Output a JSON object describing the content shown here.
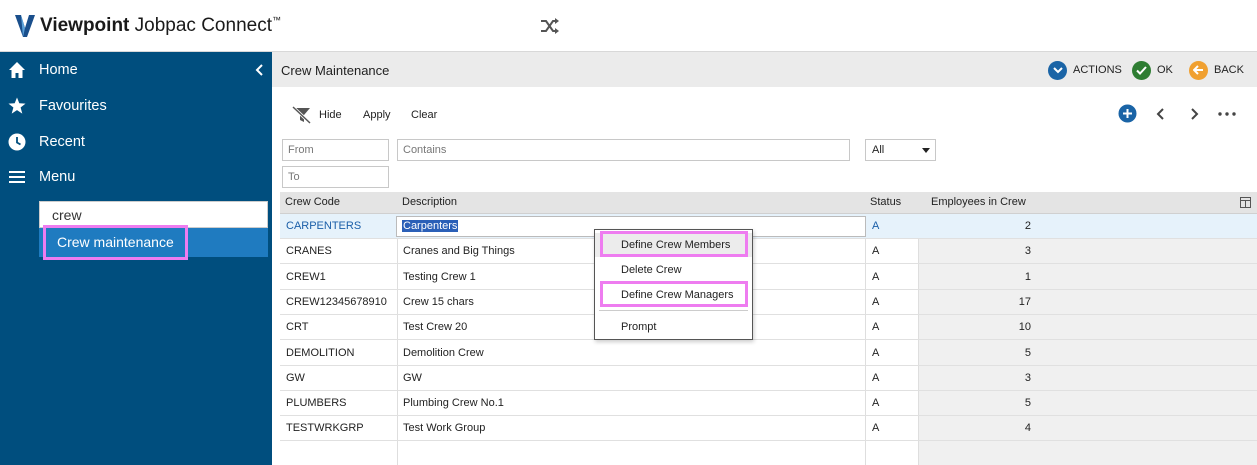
{
  "app": {
    "brand_bold": "Viewpoint",
    "brand_rest": " Jobpac Connect",
    "trademark": "™"
  },
  "sidebar": {
    "items": [
      {
        "label": "Home",
        "icon": "home-icon"
      },
      {
        "label": "Favourites",
        "icon": "star-icon"
      },
      {
        "label": "Recent",
        "icon": "clock-icon"
      },
      {
        "label": "Menu",
        "icon": "hamburger-icon"
      }
    ],
    "search_value": "crew",
    "result_label": "Crew maintenance"
  },
  "header": {
    "title": "Crew Maintenance",
    "actions_label": "ACTIONS",
    "ok_label": "OK",
    "back_label": "BACK"
  },
  "filters": {
    "hide_label": "Hide",
    "apply_label": "Apply",
    "clear_label": "Clear",
    "from_placeholder": "From",
    "to_placeholder": "To",
    "contains_placeholder": "Contains",
    "status_selected": "All"
  },
  "table": {
    "columns": [
      "Crew Code",
      "Description",
      "Status",
      "Employees in Crew"
    ],
    "rows": [
      {
        "code": "CARPENTERS",
        "description": "Carpenters",
        "status": "A",
        "employees": "2"
      },
      {
        "code": "CRANES",
        "description": "Cranes and Big Things",
        "status": "A",
        "employees": "3"
      },
      {
        "code": "CREW1",
        "description": "Testing Crew 1",
        "status": "A",
        "employees": "1"
      },
      {
        "code": "CREW12345678910",
        "description": "Crew 15 chars",
        "status": "A",
        "employees": "17"
      },
      {
        "code": "CRT",
        "description": "Test Crew 20",
        "status": "A",
        "employees": "10"
      },
      {
        "code": "DEMOLITION",
        "description": "Demolition Crew",
        "status": "A",
        "employees": "5"
      },
      {
        "code": "GW",
        "description": "GW",
        "status": "A",
        "employees": "3"
      },
      {
        "code": "PLUMBERS",
        "description": "Plumbing Crew No.1",
        "status": "A",
        "employees": "5"
      },
      {
        "code": "TESTWRKGRP",
        "description": "Test Work Group",
        "status": "A",
        "employees": "4"
      }
    ]
  },
  "context_menu": {
    "items": [
      "Define Crew Members",
      "Delete Crew",
      "Define Crew Managers",
      "Prompt"
    ]
  },
  "colors": {
    "sidebar": "#004e7e",
    "selected_result": "#1f7bc0",
    "highlight": "#ee7cf0",
    "actions": "#1a64a6",
    "ok": "#2e7d32",
    "back": "#f0a030"
  }
}
